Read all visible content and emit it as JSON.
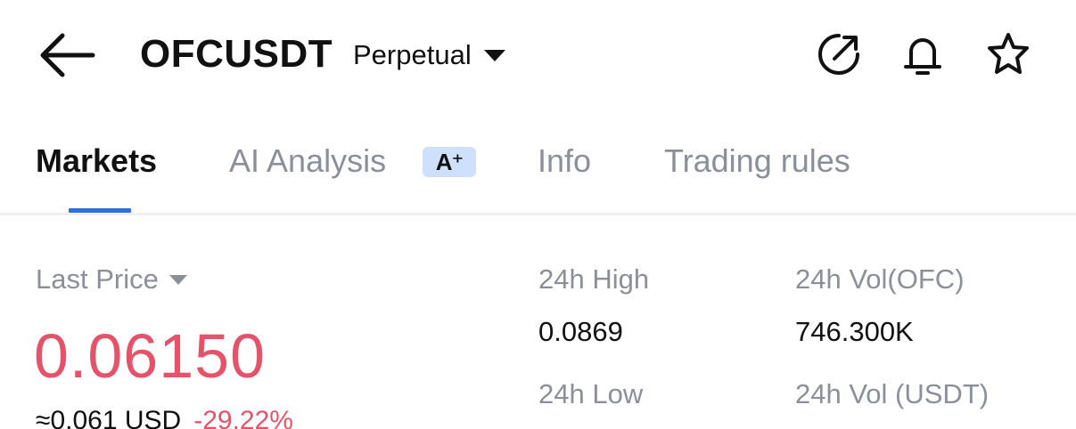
{
  "header": {
    "back_icon": "arrow-left-icon",
    "symbol": "OFCUSDT",
    "contract_type": "Perpetual",
    "icons": [
      "share-icon",
      "bell-icon",
      "star-icon"
    ]
  },
  "tabs": [
    {
      "label": "Markets",
      "active": true
    },
    {
      "label": "AI Analysis",
      "badge": "A⁺"
    },
    {
      "label": "Info"
    },
    {
      "label": "Trading rules"
    }
  ],
  "colors": {
    "accent": "#2f6fe0",
    "negative": "#e5536a",
    "muted": "#8a8f99",
    "badge_bg": "#cfe0fb"
  },
  "market": {
    "last_price_label": "Last Price",
    "last_price": "0.06150",
    "approx_value": "≈0.061 USD",
    "change_pct": "-29.22%",
    "high_label": "24h High",
    "high_value": "0.0869",
    "low_label": "24h Low",
    "vol_base_label": "24h Vol(OFC)",
    "vol_base_value": "746.300K",
    "vol_quote_label": "24h Vol (USDT)"
  }
}
